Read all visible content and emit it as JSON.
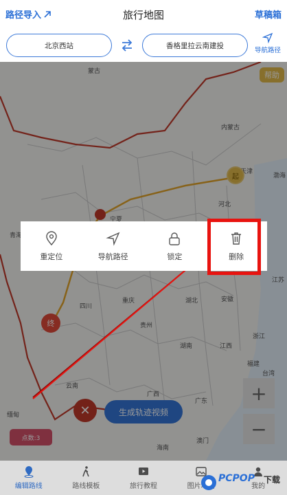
{
  "header": {
    "left_label": "路径导入",
    "title": "旅行地图",
    "right_label": "草稿箱"
  },
  "route": {
    "from": "北京西站",
    "to": "香格里拉云南建投",
    "nav_label": "导航路径"
  },
  "map": {
    "help": "帮助",
    "labels": [
      "蒙古",
      "内蒙古",
      "天津",
      "河北",
      "渤海",
      "宁夏",
      "青海",
      "四川",
      "重庆",
      "湖北",
      "安徽",
      "江苏",
      "贵州",
      "湖南",
      "江西",
      "浙江",
      "福建",
      "云南",
      "广西",
      "广东",
      "澳门",
      "海南",
      "缅甸",
      "台湾"
    ],
    "start_marker": "起",
    "end_marker": "终",
    "count_badge": "点数:3",
    "generate_button": "生成轨迹视频",
    "close_symbol": "✕",
    "zoom_in": "+",
    "zoom_out": "−",
    "dim_color": "#000000"
  },
  "popup": {
    "items": [
      {
        "label": "重定位",
        "icon": "location-pin-icon"
      },
      {
        "label": "导航路径",
        "icon": "navigation-arrow-icon"
      },
      {
        "label": "锁定",
        "icon": "lock-icon"
      },
      {
        "label": "删除",
        "icon": "trash-icon"
      }
    ],
    "highlight_color": "#e8130f"
  },
  "bottom_nav": {
    "tabs": [
      {
        "label": "编辑路线",
        "icon": "map-pin-icon",
        "active": true
      },
      {
        "label": "路线模板",
        "icon": "walking-person-icon",
        "active": false
      },
      {
        "label": "旅行教程",
        "icon": "video-icon",
        "active": false
      },
      {
        "label": "图片地图",
        "icon": "image-icon",
        "active": false
      },
      {
        "label": "我的",
        "icon": "user-icon",
        "active": false
      }
    ]
  },
  "watermark": {
    "brand": "PCPOP",
    "suffix": "下载"
  },
  "colors": {
    "accent": "#3476d8",
    "route_line": "#e2a32a",
    "border": "#c0392b"
  }
}
